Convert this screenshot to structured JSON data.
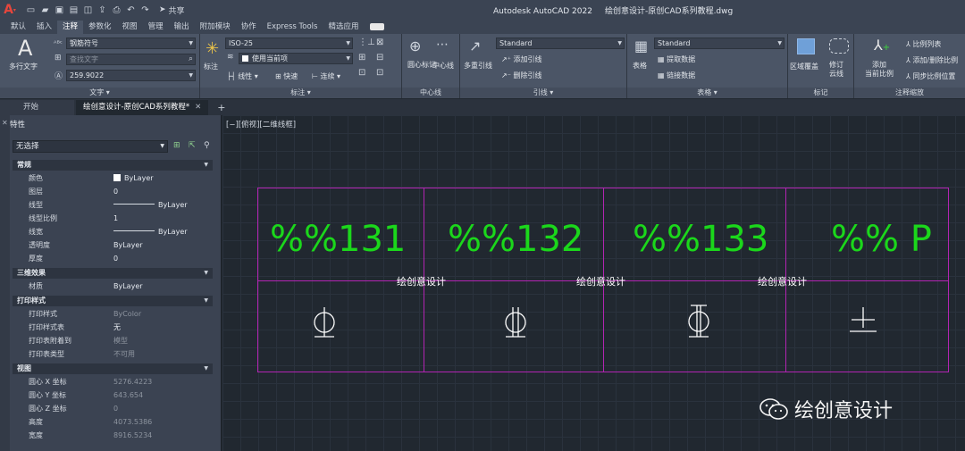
{
  "title": {
    "app": "Autodesk AutoCAD 2022",
    "file": "绘创意设计-原创CAD系列教程.dwg"
  },
  "qat": {
    "share": "共享"
  },
  "tabs": [
    "默认",
    "插入",
    "注释",
    "参数化",
    "视图",
    "管理",
    "输出",
    "附加模块",
    "协作",
    "Express Tools",
    "精选应用"
  ],
  "active_tab": "注释",
  "ribbon": {
    "text": {
      "big": "多行文字",
      "style": "钢筋符号",
      "find_placeholder": "查找文字",
      "height": "259.9022",
      "title": "文字"
    },
    "dim": {
      "big": "标注",
      "style": "ISO-25",
      "layer": "使用当前项",
      "linear": "线性",
      "quick": "快速",
      "continue": "连续",
      "title": "标注"
    },
    "centerline": {
      "mark": "圆心标记",
      "line": "中心线",
      "title": "中心线"
    },
    "leader": {
      "big": "多重引线",
      "style": "Standard",
      "add": "添加引线",
      "remove": "删除引线",
      "title": "引线"
    },
    "table": {
      "big": "表格",
      "style": "Standard",
      "extract": "提取数据",
      "link": "链接数据",
      "title": "表格"
    },
    "markup": {
      "wipeout": "区域覆盖",
      "revcloud1": "修订",
      "revcloud2": "云线",
      "title": "标记"
    },
    "scale": {
      "add1": "添加",
      "add2": "当前比例",
      "list": "比例列表",
      "adddel": "添加/删除比例",
      "sync": "同步比例位置",
      "title": "注释缩放"
    }
  },
  "doctabs": {
    "start": "开始",
    "active": "绘创意设计-原创CAD系列教程*"
  },
  "properties": {
    "header": "特性",
    "selection": "无选择",
    "sections": [
      {
        "name": "常规",
        "rows": [
          [
            "颜色",
            "ByLayer"
          ],
          [
            "图层",
            "0"
          ],
          [
            "线型",
            "ByLayer"
          ],
          [
            "线型比例",
            "1"
          ],
          [
            "线宽",
            "ByLayer"
          ],
          [
            "透明度",
            "ByLayer"
          ],
          [
            "厚度",
            "0"
          ]
        ]
      },
      {
        "name": "三维效果",
        "rows": [
          [
            "材质",
            "ByLayer"
          ]
        ]
      },
      {
        "name": "打印样式",
        "rows": [
          [
            "打印样式",
            "ByColor"
          ],
          [
            "打印样式表",
            "无"
          ],
          [
            "打印表附着到",
            "模型"
          ],
          [
            "打印表类型",
            "不可用"
          ]
        ]
      },
      {
        "name": "视图",
        "rows": [
          [
            "圆心 X 坐标",
            "5276.4223"
          ],
          [
            "圆心 Y 坐标",
            "643.654"
          ],
          [
            "圆心 Z 坐标",
            "0"
          ],
          [
            "高度",
            "4073.5386"
          ],
          [
            "宽度",
            "8916.5234"
          ]
        ]
      }
    ]
  },
  "viewport": {
    "label": "[−][俯视][二维线框]"
  },
  "drawing": {
    "codes": [
      "%%131",
      "%%132",
      "%%133",
      "%% P"
    ],
    "labels": [
      "绘创意设计",
      "绘创意设计",
      "绘创意设计"
    ],
    "symbols": [
      "phi-icon",
      "double-phi-icon",
      "phi-bar-icon",
      "plus-minus-icon"
    ]
  },
  "watermark": "绘创意设计",
  "colors": {
    "magenta": "#b224b2",
    "green": "#1bd71b"
  }
}
